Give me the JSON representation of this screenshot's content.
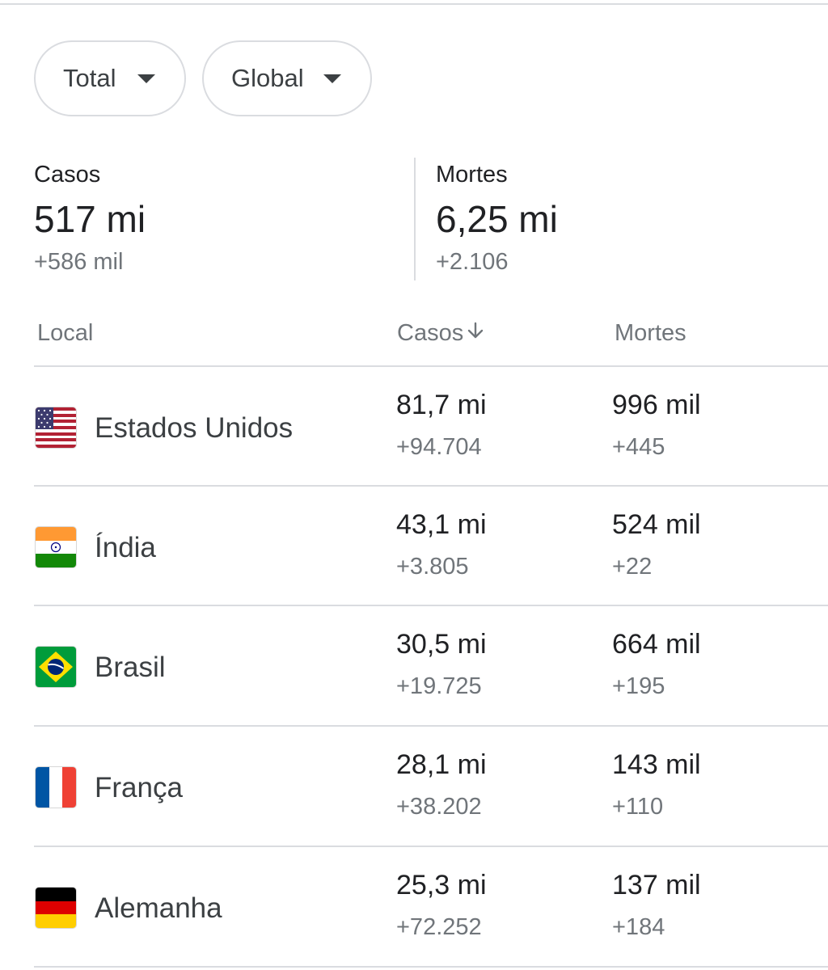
{
  "filters": {
    "period": "Total",
    "region": "Global"
  },
  "summary": {
    "cases": {
      "label": "Casos",
      "value": "517 mi",
      "delta": "+586 mil"
    },
    "deaths": {
      "label": "Mortes",
      "value": "6,25 mi",
      "delta": "+2.106"
    }
  },
  "table": {
    "headers": {
      "location": "Local",
      "cases": "Casos",
      "deaths": "Mortes"
    },
    "sort": {
      "column": "cases",
      "direction": "descending",
      "icon": "arrow-down-icon"
    },
    "rows": [
      {
        "country": "Estados Unidos",
        "flag": "us-flag-icon",
        "cases": "81,7 mi",
        "cases_delta": "+94.704",
        "deaths": "996 mil",
        "deaths_delta": "+445"
      },
      {
        "country": "Índia",
        "flag": "india-flag-icon",
        "cases": "43,1 mi",
        "cases_delta": "+3.805",
        "deaths": "524 mil",
        "deaths_delta": "+22"
      },
      {
        "country": "Brasil",
        "flag": "brazil-flag-icon",
        "cases": "30,5 mi",
        "cases_delta": "+19.725",
        "deaths": "664 mil",
        "deaths_delta": "+195"
      },
      {
        "country": "França",
        "flag": "france-flag-icon",
        "cases": "28,1 mi",
        "cases_delta": "+38.202",
        "deaths": "143 mil",
        "deaths_delta": "+110"
      },
      {
        "country": "Alemanha",
        "flag": "germany-flag-icon",
        "cases": "25,3 mi",
        "cases_delta": "+72.252",
        "deaths": "137 mil",
        "deaths_delta": "+184"
      }
    ]
  }
}
